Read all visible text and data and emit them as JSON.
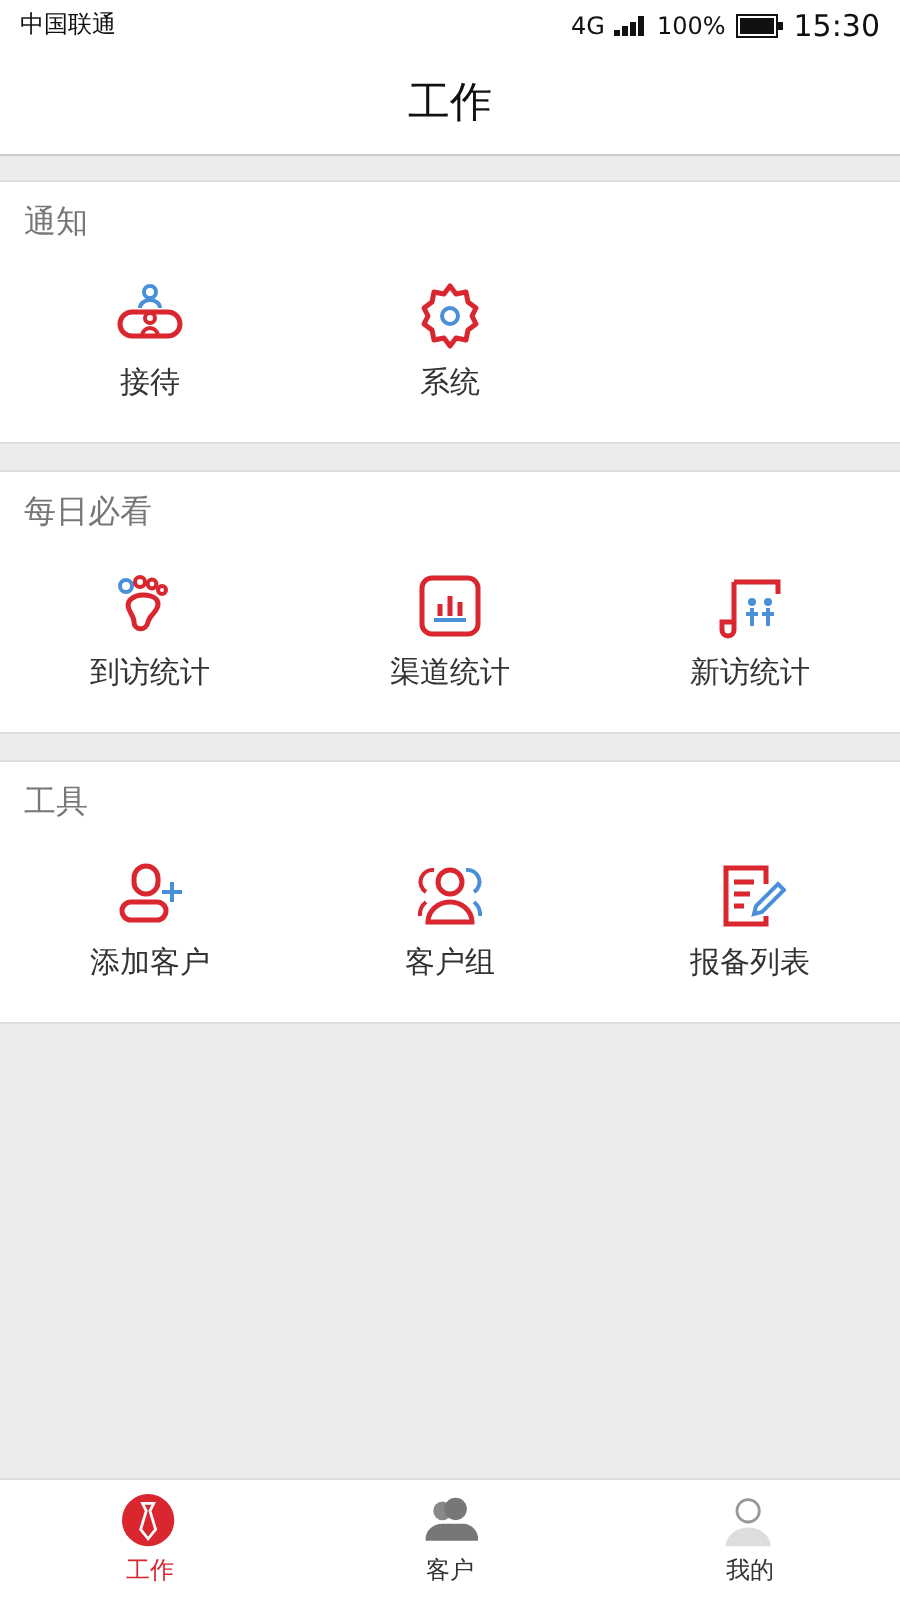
{
  "status_bar": {
    "carrier": "中国联通",
    "network": "4G",
    "battery": "100%",
    "time": "15:30"
  },
  "title": "工作",
  "sections": [
    {
      "title": "通知",
      "items": [
        {
          "label": "接待",
          "kind": "reception"
        },
        {
          "label": "系统",
          "kind": "gear"
        }
      ]
    },
    {
      "title": "每日必看",
      "items": [
        {
          "label": "到访统计",
          "kind": "foot"
        },
        {
          "label": "渠道统计",
          "kind": "chart"
        },
        {
          "label": "新访统计",
          "kind": "scroll"
        }
      ]
    },
    {
      "title": "工具",
      "items": [
        {
          "label": "添加客户",
          "kind": "adduser"
        },
        {
          "label": "客户组",
          "kind": "group"
        },
        {
          "label": "报备列表",
          "kind": "report"
        }
      ]
    }
  ],
  "tabs": [
    {
      "label": "工作",
      "kind": "tie",
      "selected": true
    },
    {
      "label": "客户",
      "kind": "people",
      "selected": false
    },
    {
      "label": "我的",
      "kind": "person",
      "selected": false
    }
  ]
}
